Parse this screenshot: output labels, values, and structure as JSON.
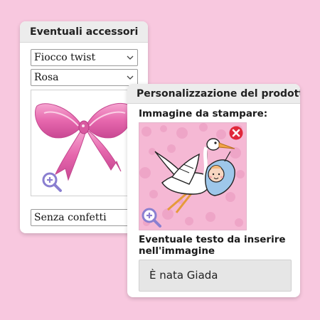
{
  "accessories": {
    "title": "Eventuali accessori",
    "ribbon_select": "Fiocco twist",
    "color_select": "Rosa",
    "confetti_select": "Senza confetti"
  },
  "personalization": {
    "title": "Personalizzazione del prodotto",
    "image_label": "Immagine da stampare:",
    "text_label_line1": "Eventuale testo da inserire",
    "text_label_line2": "nell'immagine",
    "text_value": "È nata Giada"
  },
  "colors": {
    "background": "#f8c8df",
    "bow_pink": "#e96fb0",
    "remove_red": "#e0273a",
    "zoom_purple": "#8a7fd0",
    "image_bg": "#f5b8d4"
  },
  "icons": [
    "chevron-down-icon",
    "zoom-in-icon",
    "remove-image-icon"
  ]
}
